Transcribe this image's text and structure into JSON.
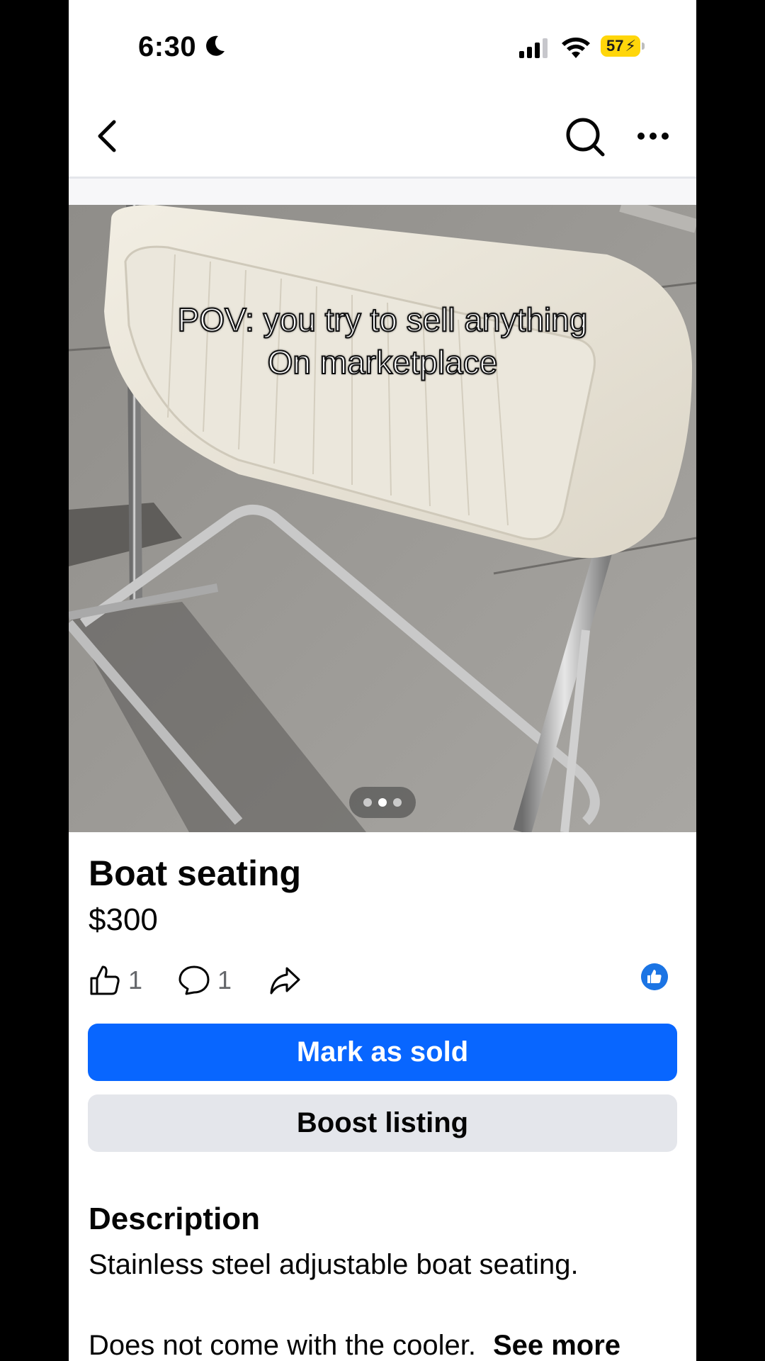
{
  "status_bar": {
    "time": "6:30",
    "battery": "57"
  },
  "nav": {
    "back_icon": "chevron-left-icon",
    "search_icon": "search-icon",
    "more_icon": "more-dots-icon"
  },
  "photo": {
    "caption_line1": "POV: you try to sell anything",
    "caption_line2": "On marketplace",
    "pager_total": 3,
    "pager_active": 2
  },
  "listing": {
    "title": "Boat seating",
    "price": "$300",
    "likes": "1",
    "comments": "1"
  },
  "buttons": {
    "mark_sold": "Mark as sold",
    "boost": "Boost listing"
  },
  "description": {
    "heading": "Description",
    "line1": "Stainless steel adjustable boat seating.",
    "line2": "Does not come with the cooler.",
    "see_more": "See more"
  },
  "colors": {
    "primary": "#0866ff",
    "secondary_button": "#e4e6eb",
    "battery": "#ffd60a",
    "like_badge": "#1b74e4"
  }
}
